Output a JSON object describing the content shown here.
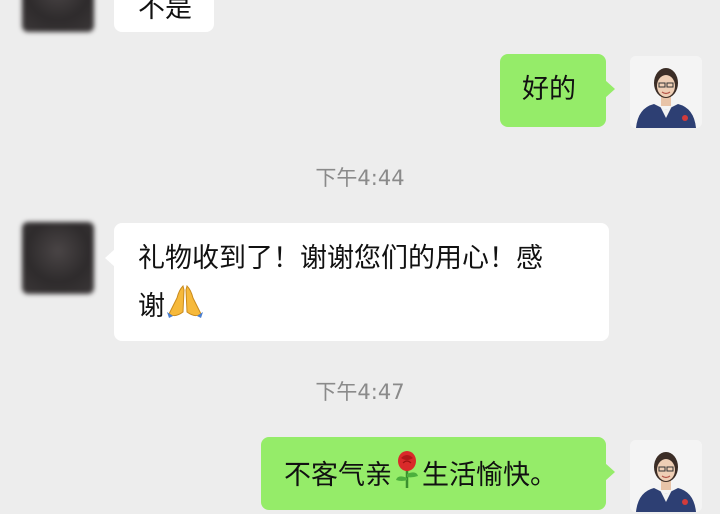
{
  "messages": [
    {
      "side": "in",
      "text": "不是"
    },
    {
      "side": "out",
      "text": "好的"
    },
    {
      "side": "in",
      "text_line1": "礼物收到了！谢谢您们的用心！感",
      "text_line2": "谢",
      "emoji": "folded-hands"
    },
    {
      "side": "out",
      "text_before": "不客气亲",
      "emoji": "rose",
      "text_after": "生活愉快。"
    }
  ],
  "timestamps": [
    "下午4:44",
    "下午4:47"
  ],
  "colors": {
    "background": "#ededed",
    "incoming_bubble": "#ffffff",
    "outgoing_bubble": "#95ec69",
    "timestamp_text": "#8a8a8a"
  }
}
